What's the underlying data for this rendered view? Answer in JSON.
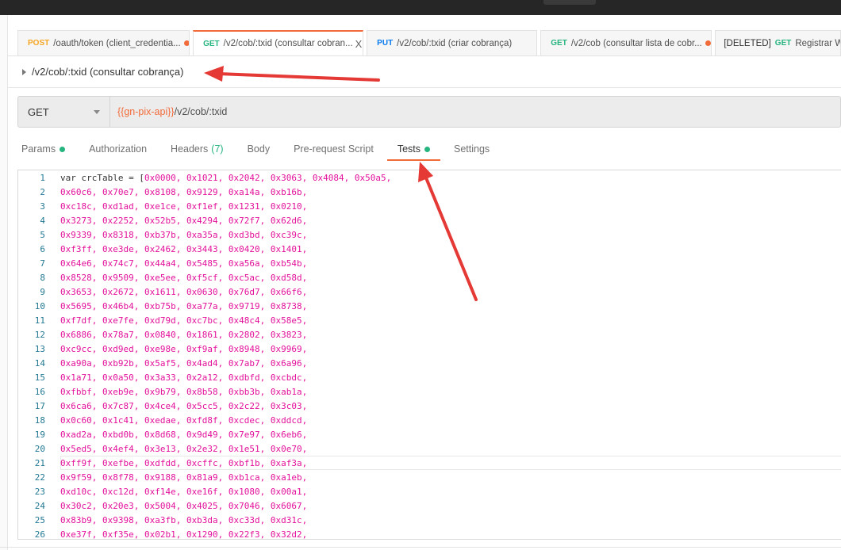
{
  "tabs": [
    {
      "method": "POST",
      "method_color": "#f5a623",
      "label": "/oauth/token (client_credentia...",
      "unsaved": true
    },
    {
      "method": "GET",
      "method_color": "#26b47f",
      "label": "/v2/cob/:txid (consultar cobran...",
      "active": true,
      "close": "X"
    },
    {
      "method": "PUT",
      "method_color": "#097bed",
      "label": "/v2/cob/:txid (criar cobrança)"
    },
    {
      "method": "GET",
      "method_color": "#26b47f",
      "label": "/v2/cob (consultar lista de cobr...",
      "unsaved": true
    },
    {
      "prefix": "[DELETED]",
      "method": "GET",
      "method_color": "#26b47f",
      "label": "Registrar W"
    }
  ],
  "request_name": "/v2/cob/:txid (consultar cobrança)",
  "url_bar": {
    "method": "GET",
    "variable": "{{gn-pix-api}}",
    "path": "/v2/cob/:txid"
  },
  "subtabs": {
    "params": "Params",
    "authorization": "Authorization",
    "headers": "Headers",
    "headers_count": "(7)",
    "body": "Body",
    "prerequest": "Pre-request Script",
    "tests": "Tests",
    "settings": "Settings"
  },
  "editor": {
    "first_line_prefix": "var crcTable = [",
    "lines": [
      "0x0000, 0x1021, 0x2042, 0x3063, 0x4084, 0x50a5,",
      "0x60c6, 0x70e7, 0x8108, 0x9129, 0xa14a, 0xb16b,",
      "0xc18c, 0xd1ad, 0xe1ce, 0xf1ef, 0x1231, 0x0210,",
      "0x3273, 0x2252, 0x52b5, 0x4294, 0x72f7, 0x62d6,",
      "0x9339, 0x8318, 0xb37b, 0xa35a, 0xd3bd, 0xc39c,",
      "0xf3ff, 0xe3de, 0x2462, 0x3443, 0x0420, 0x1401,",
      "0x64e6, 0x74c7, 0x44a4, 0x5485, 0xa56a, 0xb54b,",
      "0x8528, 0x9509, 0xe5ee, 0xf5cf, 0xc5ac, 0xd58d,",
      "0x3653, 0x2672, 0x1611, 0x0630, 0x76d7, 0x66f6,",
      "0x5695, 0x46b4, 0xb75b, 0xa77a, 0x9719, 0x8738,",
      "0xf7df, 0xe7fe, 0xd79d, 0xc7bc, 0x48c4, 0x58e5,",
      "0x6886, 0x78a7, 0x0840, 0x1861, 0x2802, 0x3823,",
      "0xc9cc, 0xd9ed, 0xe98e, 0xf9af, 0x8948, 0x9969,",
      "0xa90a, 0xb92b, 0x5af5, 0x4ad4, 0x7ab7, 0x6a96,",
      "0x1a71, 0x0a50, 0x3a33, 0x2a12, 0xdbfd, 0xcbdc,",
      "0xfbbf, 0xeb9e, 0x9b79, 0x8b58, 0xbb3b, 0xab1a,",
      "0x6ca6, 0x7c87, 0x4ce4, 0x5cc5, 0x2c22, 0x3c03,",
      "0x0c60, 0x1c41, 0xedae, 0xfd8f, 0xcdec, 0xddcd,",
      "0xad2a, 0xbd0b, 0x8d68, 0x9d49, 0x7e97, 0x6eb6,",
      "0x5ed5, 0x4ef4, 0x3e13, 0x2e32, 0x1e51, 0x0e70,",
      "0xff9f, 0xefbe, 0xdfdd, 0xcffc, 0xbf1b, 0xaf3a,",
      "0x9f59, 0x8f78, 0x9188, 0x81a9, 0xb1ca, 0xa1eb,",
      "0xd10c, 0xc12d, 0xf14e, 0xe16f, 0x1080, 0x00a1,",
      "0x30c2, 0x20e3, 0x5004, 0x4025, 0x7046, 0x6067,",
      "0x83b9, 0x9398, 0xa3fb, 0xb3da, 0xc33d, 0xd31c,",
      "0xe37f, 0xf35e, 0x02b1, 0x1290, 0x22f3, 0x32d2,"
    ]
  },
  "colors": {
    "accent": "#f26b3a",
    "green": "#26b47f",
    "annotation_arrow": "#e53935",
    "code_literal": "#e3119b"
  }
}
